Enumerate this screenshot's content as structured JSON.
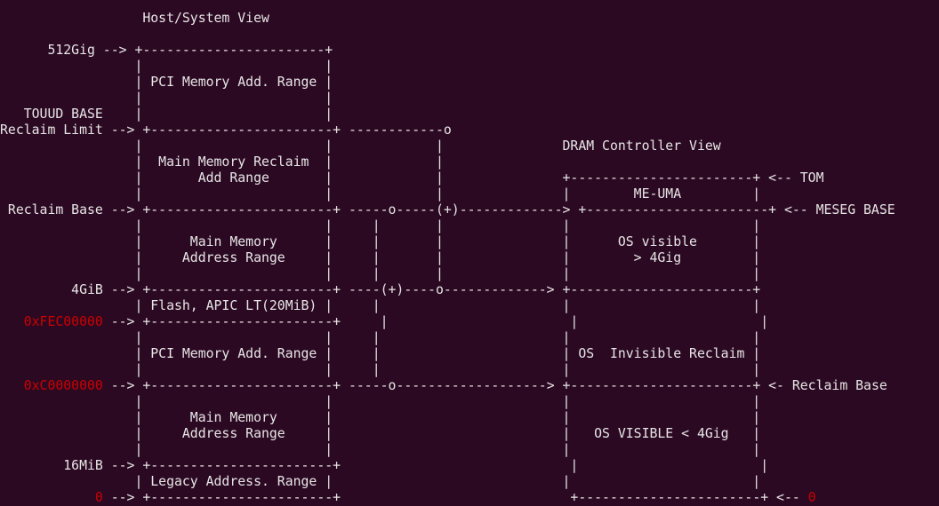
{
  "colors": {
    "background": "#2c0922",
    "text": "#e6e6e6",
    "highlight": "#cc0000"
  },
  "lines": [
    [
      {
        "t": "                  Host/System View"
      }
    ],
    [
      {
        "t": ""
      }
    ],
    [
      {
        "t": "      512Gig --> +-----------------------+"
      }
    ],
    [
      {
        "t": "                 |                       |"
      }
    ],
    [
      {
        "t": "                 | PCI Memory Add. Range |"
      }
    ],
    [
      {
        "t": "                 |                       |"
      }
    ],
    [
      {
        "t": "   TOUUD BASE    |                       |"
      }
    ],
    [
      {
        "t": "Reclaim Limit --> +-----------------------+ ------------o"
      }
    ],
    [
      {
        "t": "                 |                       |             |               DRAM Controller View"
      }
    ],
    [
      {
        "t": "                 |  Main Memory Reclaim  |             |"
      }
    ],
    [
      {
        "t": "                 |       Add Range       |             |               +-----------------------+ <-- TOM"
      }
    ],
    [
      {
        "t": "                 |                       |             |               |        ME-UMA         |"
      }
    ],
    [
      {
        "t": " Reclaim Base --> +-----------------------+ -----o-----(+)-------------> +-----------------------+ <-- MESEG BASE"
      }
    ],
    [
      {
        "t": "                 |                       |     |       |               |                       |"
      }
    ],
    [
      {
        "t": "                 |      Main Memory      |     |       |               |      OS visible       |"
      }
    ],
    [
      {
        "t": "                 |     Address Range     |     |       |               |        > 4Gig         |"
      }
    ],
    [
      {
        "t": "                 |                       |     |       |               |                       |"
      }
    ],
    [
      {
        "t": "         4GiB --> +-----------------------+ ----(+)----o-------------> +-----------------------+"
      }
    ],
    [
      {
        "t": "                 | Flash, APIC LT(20MiB) |     |                       |                       |"
      }
    ],
    [
      {
        "t": "   "
      },
      {
        "t": "0xFEC00000",
        "r": true
      },
      {
        "t": " --> +-----------------------+     |                       |                       |"
      }
    ],
    [
      {
        "t": "                 |                       |     |                       |                       |"
      }
    ],
    [
      {
        "t": "                 | PCI Memory Add. Range |     |                       | OS  Invisible Reclaim |"
      }
    ],
    [
      {
        "t": "                 |                       |     |                       |                       |"
      }
    ],
    [
      {
        "t": "   "
      },
      {
        "t": "0xC0000000",
        "r": true
      },
      {
        "t": " --> +-----------------------+ -----o-------------------> +-----------------------+ <- Reclaim Base"
      }
    ],
    [
      {
        "t": "                 |                       |                             |                       |"
      }
    ],
    [
      {
        "t": "                 |      Main Memory      |                             |                       |"
      }
    ],
    [
      {
        "t": "                 |     Address Range     |                             |   OS VISIBLE < 4Gig   |"
      }
    ],
    [
      {
        "t": "                 |                       |                             |                       |"
      }
    ],
    [
      {
        "t": "        16MiB --> +-----------------------+                             |                       |"
      }
    ],
    [
      {
        "t": "                 | Legacy Address. Range |                             |                       |"
      }
    ],
    [
      {
        "t": "            "
      },
      {
        "t": "0",
        "r": true
      },
      {
        "t": " --> +-----------------------+                             +-----------------------+ <-- "
      },
      {
        "t": "0",
        "r": true
      }
    ]
  ]
}
